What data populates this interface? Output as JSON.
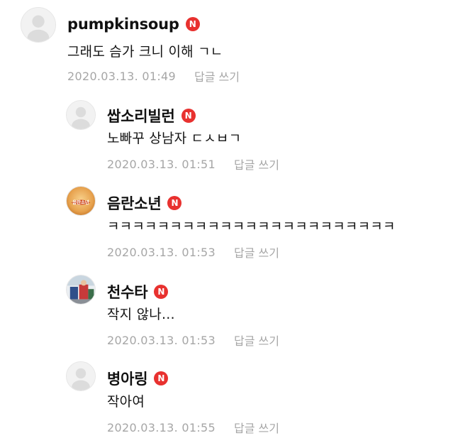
{
  "comments": [
    {
      "author": "pumpkinsoup",
      "badge": "N",
      "text": "그래도 슴가 크니 이해 ㄱㄴ",
      "date": "2020.03.13. 01:49",
      "reply_label": "답글 쓰기",
      "avatar_icon": "default-profile-icon"
    },
    {
      "author": "쌉소리빌런",
      "badge": "N",
      "text": "노빠꾸 상남자 ㄷㅅㅂㄱ",
      "date": "2020.03.13. 01:51",
      "reply_label": "답글 쓰기",
      "avatar_icon": "default-profile-icon"
    },
    {
      "author": "음란소년",
      "badge": "N",
      "text": "ㅋㅋㅋㅋㅋㅋㅋㅋㅋㅋㅋㅋㅋㅋㅋㅋㅋㅋㅋㅋㅋㅋㅋ",
      "date": "2020.03.13. 01:53",
      "reply_label": "답글 쓰기",
      "avatar_icon": "custom-profile-image",
      "avatar_text": "음란소년"
    },
    {
      "author": "천수타",
      "badge": "N",
      "text": "작지 않나...",
      "date": "2020.03.13. 01:53",
      "reply_label": "답글 쓰기",
      "avatar_icon": "photo-profile-image"
    },
    {
      "author": "병아링",
      "badge": "N",
      "text": "작아여",
      "date": "2020.03.13. 01:55",
      "reply_label": "답글 쓰기",
      "avatar_icon": "default-profile-icon"
    }
  ],
  "colors": {
    "badge": "#e8312f",
    "meta_text": "#a6a6a6",
    "avatar_bg": "#f2f2f2"
  }
}
